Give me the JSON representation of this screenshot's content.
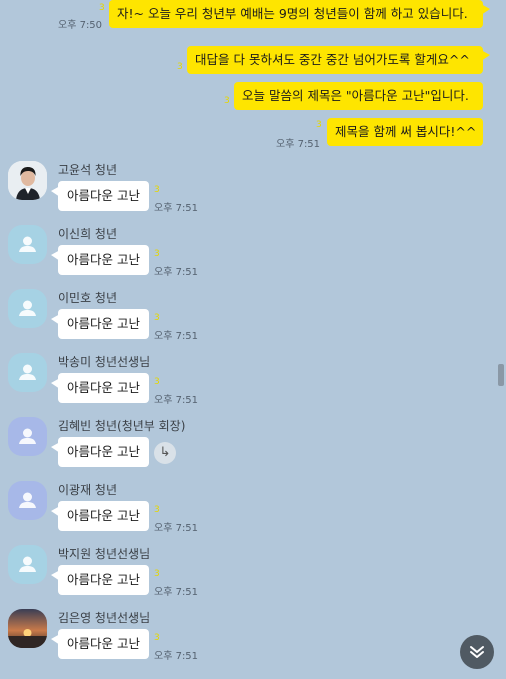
{
  "outgoing": [
    {
      "text": "자!~ 오늘 우리 청년부 예배는 9명의 청년들이 함께 하고 있습니다.",
      "unread": "3",
      "time": "오후 7:50"
    },
    {
      "text": "대답을 다 못하셔도 중간 중간 넘어가도록 할게요^^",
      "unread": "3",
      "time": ""
    },
    {
      "text": "오늘 말씀의 제목은 \"아름다운 고난\"입니다.",
      "unread": "3",
      "time": ""
    },
    {
      "text": "제목을 함께 써 봅시다!^^",
      "unread": "3",
      "time": "오후 7:51"
    }
  ],
  "incoming": [
    {
      "sender": "고윤석 청년",
      "text": "아름다운 고난",
      "unread": "3",
      "time": "오후 7:51",
      "avatar": "photo-man"
    },
    {
      "sender": "이신희 청년",
      "text": "아름다운 고난",
      "unread": "3",
      "time": "오후 7:51",
      "avatar": "default-person"
    },
    {
      "sender": "이민호 청년",
      "text": "아름다운 고난",
      "unread": "3",
      "time": "오후 7:51",
      "avatar": "default-person"
    },
    {
      "sender": "박송미 청년선생님",
      "text": "아름다운 고난",
      "unread": "3",
      "time": "오후 7:51",
      "avatar": "default-person"
    },
    {
      "sender": "김혜빈 청년(청년부 회장)",
      "text": "아름다운 고난",
      "unread": "",
      "time": "",
      "avatar": "default-person-purple"
    },
    {
      "sender": "이광재 청년",
      "text": "아름다운 고난",
      "unread": "3",
      "time": "오후 7:51",
      "avatar": "default-person-purple"
    },
    {
      "sender": "박지원 청년선생님",
      "text": "아름다운 고난",
      "unread": "3",
      "time": "오후 7:51",
      "avatar": "default-person"
    },
    {
      "sender": "김은영 청년선생님",
      "text": "아름다운 고난",
      "unread": "3",
      "time": "오후 7:51",
      "avatar": "photo-sunset"
    }
  ],
  "reply_icon": "↳",
  "scroll_down_icon": "chevron-down-double",
  "colors": {
    "background": "#b2c7da",
    "outgoing_bubble": "#fee500",
    "incoming_bubble": "#ffffff",
    "unread": "#e5d700"
  }
}
